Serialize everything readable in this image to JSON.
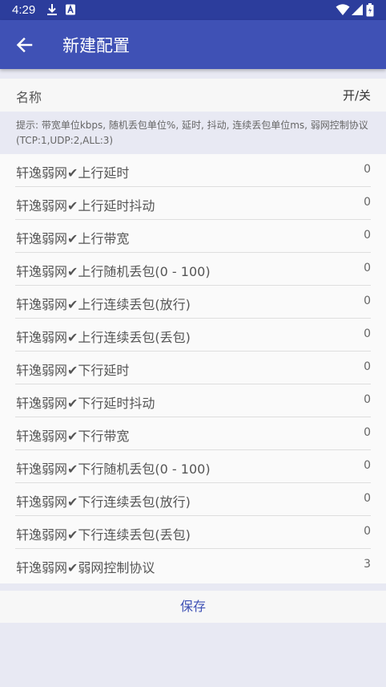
{
  "status_bar": {
    "time": "4:29",
    "icons": [
      "download-icon",
      "notification-a-icon",
      "wifi-icon",
      "signal-icon",
      "battery-icon"
    ]
  },
  "app_bar": {
    "title": "新建配置",
    "back_icon": "arrow-back-icon",
    "color": "#3f51b5"
  },
  "config": {
    "name_label": "名称",
    "toggle_label": "开/关",
    "hint": "提示: 带宽单位kbps, 随机丢包单位%, 延时, 抖动, 连续丢包单位ms, 弱网控制协议(TCP:1,UDP:2,ALL:3)"
  },
  "settings": [
    {
      "label": "轩逸弱网✔上行延时",
      "value": "0"
    },
    {
      "label": "轩逸弱网✔上行延时抖动",
      "value": "0"
    },
    {
      "label": "轩逸弱网✔上行带宽",
      "value": "0"
    },
    {
      "label": "轩逸弱网✔上行随机丢包(0 - 100)",
      "value": "0"
    },
    {
      "label": "轩逸弱网✔上行连续丢包(放行)",
      "value": "0"
    },
    {
      "label": "轩逸弱网✔上行连续丢包(丢包)",
      "value": "0"
    },
    {
      "label": "轩逸弱网✔下行延时",
      "value": "0"
    },
    {
      "label": "轩逸弱网✔下行延时抖动",
      "value": "0"
    },
    {
      "label": "轩逸弱网✔下行带宽",
      "value": "0"
    },
    {
      "label": "轩逸弱网✔下行随机丢包(0 - 100)",
      "value": "0"
    },
    {
      "label": "轩逸弱网✔下行连续丢包(放行)",
      "value": "0"
    },
    {
      "label": "轩逸弱网✔下行连续丢包(丢包)",
      "value": "0"
    },
    {
      "label": "轩逸弱网✔弱网控制协议",
      "value": "3"
    }
  ],
  "save_button": {
    "label": "保存"
  }
}
